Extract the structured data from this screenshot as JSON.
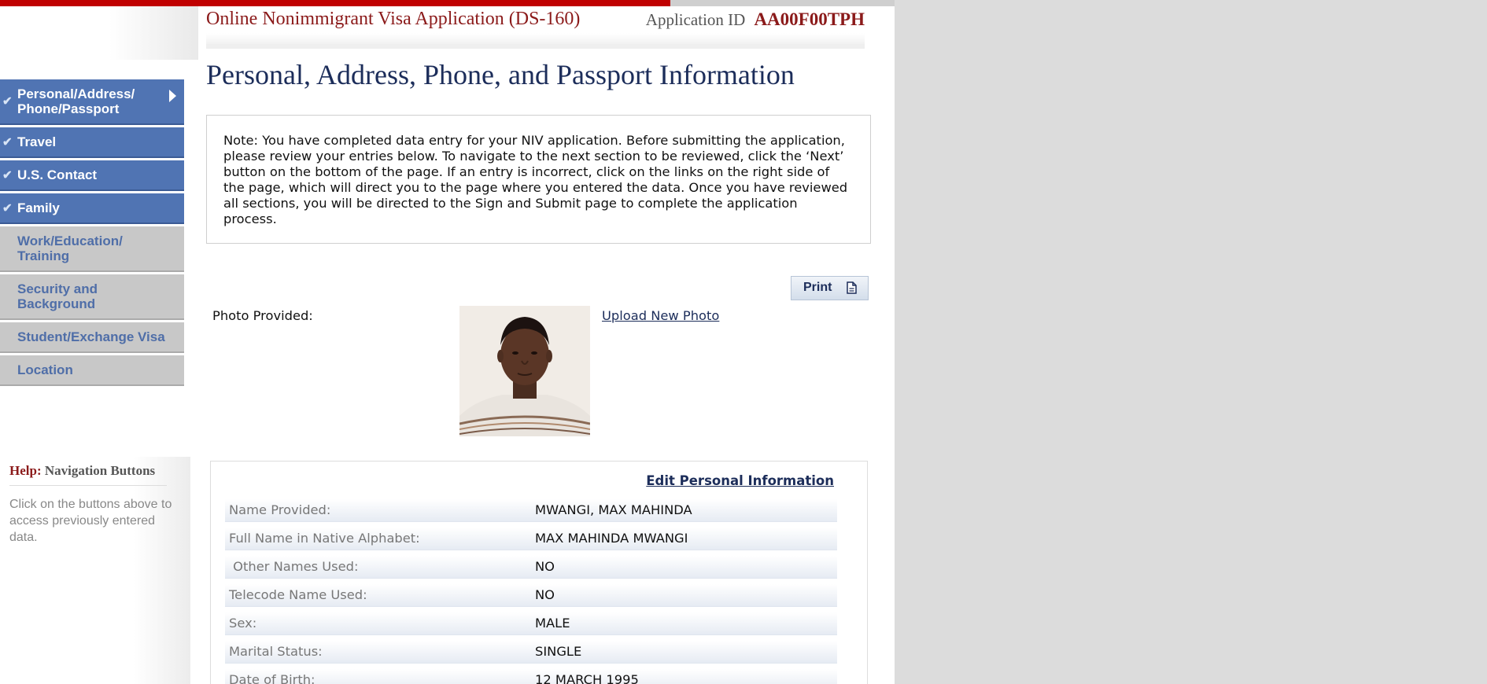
{
  "header": {
    "app_title": "Online Nonimmigrant Visa Application (DS-160)",
    "app_id_label": "Application ID",
    "app_id_value": "AA00F00TPH"
  },
  "page_title": "Personal, Address, Phone, and Passport Information",
  "sidebar": {
    "items": [
      {
        "label": "Personal/Address/ Phone/Passport",
        "completed": true,
        "current": true
      },
      {
        "label": "Travel",
        "completed": true
      },
      {
        "label": "U.S. Contact",
        "completed": true
      },
      {
        "label": "Family",
        "completed": true
      },
      {
        "label": "Work/Education/ Training",
        "completed": false
      },
      {
        "label": "Security and Background",
        "completed": false
      },
      {
        "label": "Student/Exchange Visa",
        "completed": false
      },
      {
        "label": "Location",
        "completed": false
      }
    ]
  },
  "help": {
    "prefix": "Help:",
    "title": "Navigation Buttons",
    "text": "Click on the buttons above to access previously entered data."
  },
  "note": "Note: You have completed data entry for your NIV application. Before submitting the application, please review your entries below. To navigate to the next section to be reviewed, click the ‘Next’ button on the bottom of the page. If an entry is incorrect, click on the links on the right side of the page, which will direct you to the page where you entered the data. Once you have reviewed all sections, you will be directed to the Sign and Submit page to complete the application process.",
  "print_label": "Print",
  "photo": {
    "label": "Photo Provided:",
    "upload_link": "Upload New Photo"
  },
  "details": {
    "edit_link": "Edit Personal Information",
    "rows": [
      {
        "label": "Name Provided:",
        "value": "MWANGI, MAX MAHINDA"
      },
      {
        "label": "Full Name in Native Alphabet:",
        "value": "MAX MAHINDA MWANGI"
      },
      {
        "label": " Other Names Used:",
        "value": "NO"
      },
      {
        "label": "Telecode Name Used:",
        "value": "NO"
      },
      {
        "label": "Sex:",
        "value": "MALE"
      },
      {
        "label": "Marital Status:",
        "value": "SINGLE"
      },
      {
        "label": "Date of Birth:",
        "value": "12 MARCH 1995"
      }
    ]
  },
  "colors": {
    "brand_red": "#8b1a1a",
    "nav_done": "#5074b3",
    "nav_todo": "#c8c8c8",
    "title_navy": "#1c2d5a"
  }
}
